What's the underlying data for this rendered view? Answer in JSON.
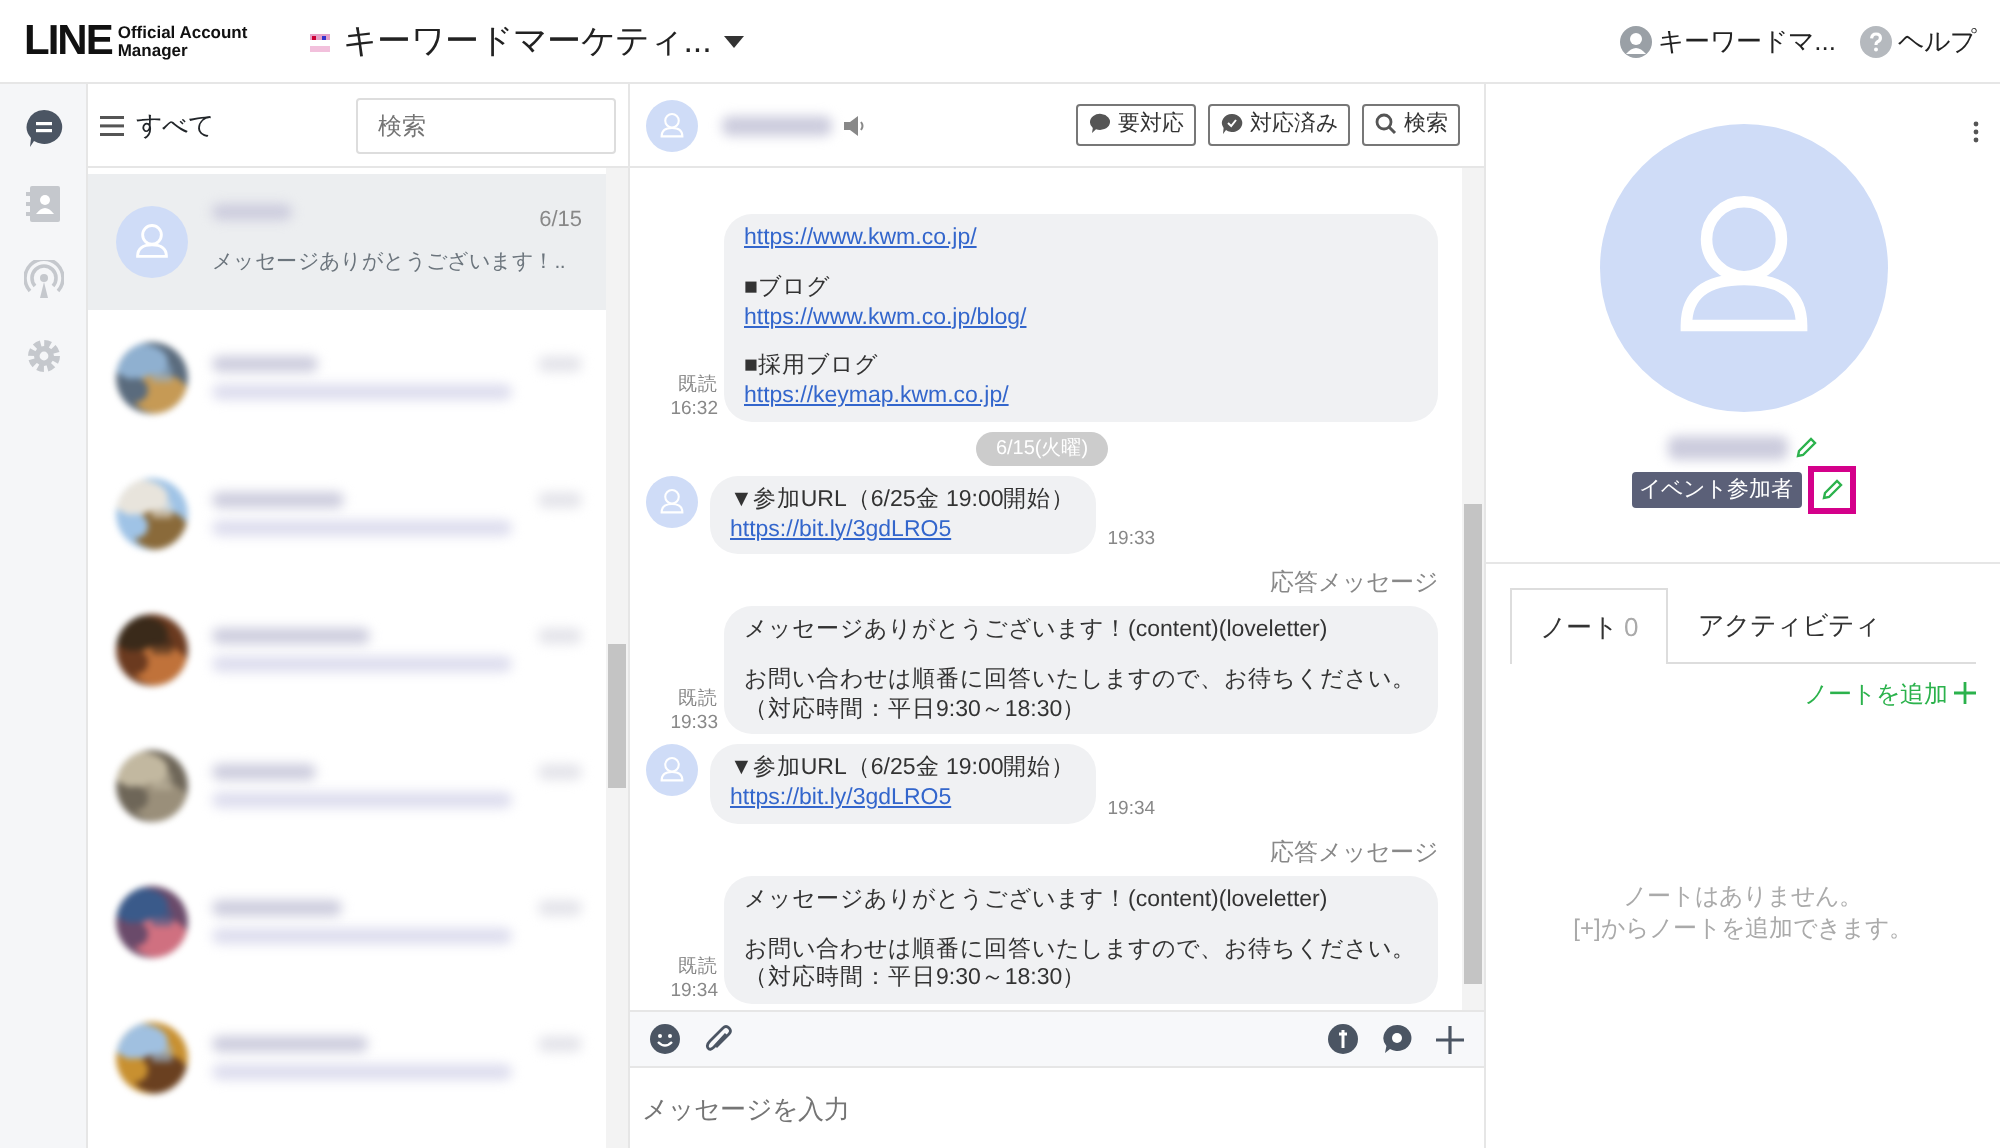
{
  "header": {
    "logo": "LINE",
    "logo_sub": [
      "Official Account",
      "Manager"
    ],
    "account": "キーワードマーケティ...",
    "user": "キーワードマ...",
    "help": "ヘルプ"
  },
  "rail": [
    {
      "kind": "chat",
      "selected": true
    },
    {
      "kind": "contacts",
      "selected": false
    },
    {
      "kind": "broadcast",
      "selected": false
    },
    {
      "kind": "settings",
      "selected": false
    }
  ],
  "chat_list": {
    "filter": "すべて",
    "search": {
      "placeholder": "検索"
    },
    "conversations": [
      {
        "selected": true,
        "preview": "メッセージありがとうございます！..",
        "date": "6/15"
      },
      {
        "selected": false
      },
      {
        "selected": false
      },
      {
        "selected": false
      },
      {
        "selected": false
      },
      {
        "selected": false
      },
      {
        "selected": false
      }
    ]
  },
  "chat": {
    "buttons": [
      {
        "kind": "flag",
        "label": "要対応"
      },
      {
        "kind": "done",
        "label": "対応済み"
      },
      {
        "kind": "search",
        "label": "検索"
      }
    ],
    "messages": [
      {
        "kind": "out",
        "read": "既読",
        "time": "16:32",
        "lines": [
          {
            "kind": "link",
            "text": "https://www.kwm.co.jp/"
          },
          {
            "kind": "blank"
          },
          {
            "kind": "text",
            "text": "■ブログ"
          },
          {
            "kind": "link",
            "text": "https://www.kwm.co.jp/blog/"
          },
          {
            "kind": "blank"
          },
          {
            "kind": "text",
            "text": "■採用ブログ"
          },
          {
            "kind": "link",
            "text": "https://keymap.kwm.co.jp/"
          }
        ]
      },
      {
        "kind": "date",
        "text": "6/15(火曜)"
      },
      {
        "kind": "in",
        "time": "19:33",
        "lines": [
          {
            "kind": "text",
            "text": "▼参加URL（6/25金 19:00開始）"
          },
          {
            "kind": "link",
            "text": "https://bit.ly/3gdLRO5"
          }
        ]
      },
      {
        "kind": "out",
        "label": "応答メッセージ",
        "read": "既読",
        "time": "19:33",
        "lines": [
          {
            "kind": "text",
            "text": "メッセージありがとうございます！(content)(loveletter)"
          },
          {
            "kind": "blank"
          },
          {
            "kind": "text",
            "text": "お問い合わせは順番に回答いたしますので、お待ちください。（対応時間：平日9:30～18:30）"
          }
        ]
      },
      {
        "kind": "in",
        "time": "19:34",
        "lines": [
          {
            "kind": "text",
            "text": "▼参加URL（6/25金 19:00開始）"
          },
          {
            "kind": "link",
            "text": "https://bit.ly/3gdLRO5"
          }
        ]
      },
      {
        "kind": "out",
        "label": "応答メッセージ",
        "read": "既読",
        "time": "19:34",
        "lines": [
          {
            "kind": "text",
            "text": "メッセージありがとうございます！(content)(loveletter)"
          },
          {
            "kind": "blank"
          },
          {
            "kind": "text",
            "text": "お問い合わせは順番に回答いたしますので、お待ちください。（対応時間：平日9:30～18:30）"
          }
        ]
      }
    ],
    "input": {
      "placeholder": "メッセージを入力"
    }
  },
  "profile": {
    "tag": "イベント参加者",
    "tag_edit_highlighted": true,
    "tabs": [
      {
        "label": "ノート",
        "count": "0",
        "selected": true
      },
      {
        "label": "アクティビティ",
        "selected": false
      }
    ],
    "add_note": "ノートを追加",
    "empty": [
      "ノートはありません。",
      "[+]からノートを追加できます。"
    ]
  }
}
